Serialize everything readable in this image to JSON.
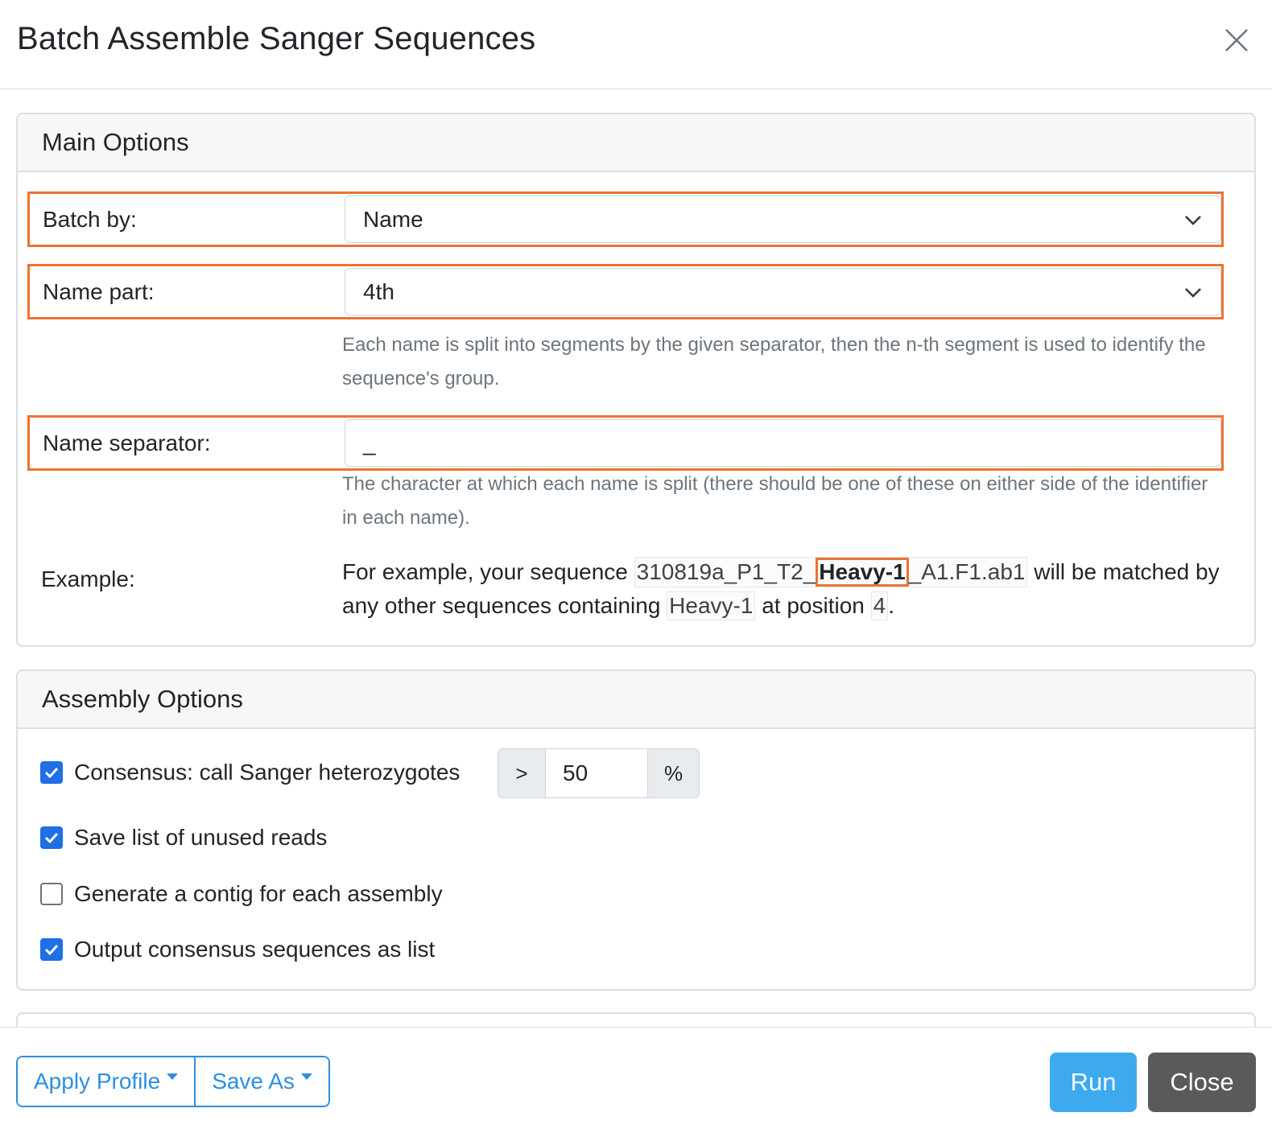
{
  "dialog": {
    "title": "Batch Assemble Sanger Sequences",
    "close_icon": "close-icon"
  },
  "main_options": {
    "header": "Main Options",
    "batch_by": {
      "label": "Batch by:",
      "value": "Name"
    },
    "name_part": {
      "label": "Name part:",
      "value": "4th",
      "help": "Each name is split into segments by the given separator, then the n-th segment is used to identify the sequence's group."
    },
    "name_separator": {
      "label": "Name separator:",
      "value": "_",
      "help": "The character at which each name is split (there should be one of these on either side of the identifier in each name)."
    },
    "example": {
      "label": "Example:",
      "text_before": "For example, your sequence ",
      "seq_prefix": "310819a_P1_T2_",
      "seq_highlight": "Heavy-1",
      "seq_suffix": "_A1.F1.ab1",
      "text_middle": " will be matched by any other sequences containing ",
      "identifier": "Heavy-1",
      "text_position": " at position ",
      "position": "4",
      "text_end": "."
    }
  },
  "assembly_options": {
    "header": "Assembly Options",
    "options": [
      {
        "label": "Consensus: call Sanger heterozygotes",
        "checked": true
      },
      {
        "label": "Save list of unused reads",
        "checked": true
      },
      {
        "label": "Generate a contig for each assembly",
        "checked": false
      },
      {
        "label": "Output consensus sequences as list",
        "checked": true
      }
    ],
    "threshold": {
      "prefix": ">",
      "value": "50",
      "suffix": "%"
    }
  },
  "footer": {
    "apply_profile": "Apply Profile",
    "save_as": "Save As",
    "run": "Run",
    "close": "Close"
  },
  "colors": {
    "highlight": "#ec7331",
    "checkbox": "#1f6fe5",
    "primary_outline": "#2d8ee0",
    "run": "#3daaf0",
    "close": "#585a5c"
  }
}
